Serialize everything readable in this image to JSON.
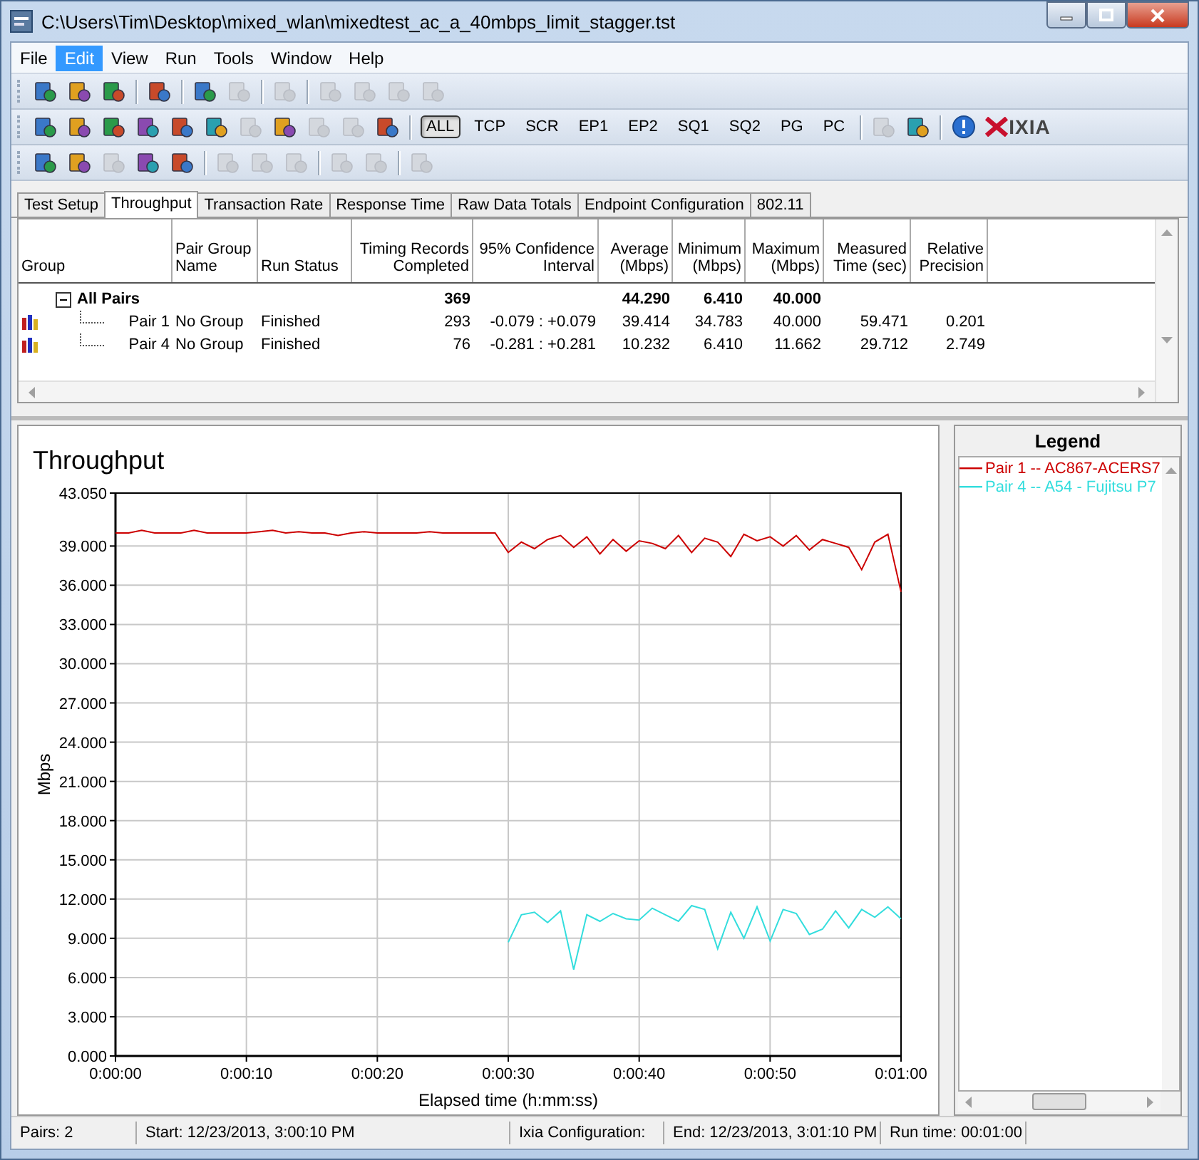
{
  "window": {
    "title": "C:\\Users\\Tim\\Desktop\\mixed_wlan\\mixedtest_ac_a_40mbps_limit_stagger.tst"
  },
  "menu": [
    {
      "label": "File",
      "selected": false
    },
    {
      "label": "Edit",
      "selected": true
    },
    {
      "label": "View",
      "selected": false
    },
    {
      "label": "Run",
      "selected": false
    },
    {
      "label": "Tools",
      "selected": false
    },
    {
      "label": "Window",
      "selected": false
    },
    {
      "label": "Help",
      "selected": false
    }
  ],
  "toolbars": [
    [
      {
        "kind": "icon",
        "disabled": false
      },
      {
        "kind": "icon",
        "disabled": false
      },
      {
        "kind": "icon",
        "disabled": false
      },
      {
        "kind": "separator"
      },
      {
        "kind": "icon",
        "disabled": false
      },
      {
        "kind": "separator"
      },
      {
        "kind": "icon",
        "disabled": false
      },
      {
        "kind": "icon",
        "disabled": true
      },
      {
        "kind": "separator"
      },
      {
        "kind": "icon",
        "disabled": true
      },
      {
        "kind": "separator"
      },
      {
        "kind": "icon",
        "disabled": true
      },
      {
        "kind": "icon",
        "disabled": true
      },
      {
        "kind": "icon",
        "disabled": true
      },
      {
        "kind": "icon",
        "disabled": true
      }
    ],
    [
      {
        "kind": "icon",
        "disabled": false
      },
      {
        "kind": "icon",
        "disabled": false
      },
      {
        "kind": "icon",
        "disabled": false
      },
      {
        "kind": "icon",
        "disabled": false
      },
      {
        "kind": "icon",
        "disabled": false
      },
      {
        "kind": "icon",
        "disabled": false
      },
      {
        "kind": "icon",
        "disabled": true
      },
      {
        "kind": "icon",
        "disabled": false
      },
      {
        "kind": "icon",
        "disabled": true
      },
      {
        "kind": "icon",
        "disabled": true
      },
      {
        "kind": "icon",
        "disabled": false
      },
      {
        "kind": "separator"
      },
      {
        "kind": "toggle",
        "label": "ALL",
        "selected": true
      },
      {
        "kind": "toggle",
        "label": "TCP",
        "selected": false
      },
      {
        "kind": "toggle",
        "label": "SCR",
        "selected": false
      },
      {
        "kind": "toggle",
        "label": "EP1",
        "selected": false
      },
      {
        "kind": "toggle",
        "label": "EP2",
        "selected": false
      },
      {
        "kind": "toggle",
        "label": "SQ1",
        "selected": false
      },
      {
        "kind": "toggle",
        "label": "SQ2",
        "selected": false
      },
      {
        "kind": "toggle",
        "label": "PG",
        "selected": false
      },
      {
        "kind": "toggle",
        "label": "PC",
        "selected": false
      },
      {
        "kind": "separator"
      },
      {
        "kind": "icon",
        "disabled": true
      },
      {
        "kind": "icon",
        "disabled": false
      },
      {
        "kind": "separator"
      },
      {
        "kind": "info"
      },
      {
        "kind": "logo",
        "label": "IXIA"
      }
    ],
    [
      {
        "kind": "icon",
        "disabled": false
      },
      {
        "kind": "icon",
        "disabled": false
      },
      {
        "kind": "icon",
        "disabled": true
      },
      {
        "kind": "icon",
        "disabled": false
      },
      {
        "kind": "icon",
        "disabled": false
      },
      {
        "kind": "separator"
      },
      {
        "kind": "icon",
        "disabled": true
      },
      {
        "kind": "icon",
        "disabled": true
      },
      {
        "kind": "icon",
        "disabled": true
      },
      {
        "kind": "separator"
      },
      {
        "kind": "icon",
        "disabled": true
      },
      {
        "kind": "icon",
        "disabled": true
      },
      {
        "kind": "separator"
      },
      {
        "kind": "icon",
        "disabled": true
      }
    ]
  ],
  "tabs": [
    {
      "label": "Test Setup",
      "selected": false
    },
    {
      "label": "Throughput",
      "selected": true
    },
    {
      "label": "Transaction Rate",
      "selected": false
    },
    {
      "label": "Response Time",
      "selected": false
    },
    {
      "label": "Raw Data Totals",
      "selected": false
    },
    {
      "label": "Endpoint Configuration",
      "selected": false
    },
    {
      "label": "802.11",
      "selected": false
    }
  ],
  "table": {
    "columns": [
      "Group",
      "Pair Group\nName",
      "Run Status",
      "Timing Records\nCompleted",
      "95% Confidence\nInterval",
      "Average\n(Mbps)",
      "Minimum\n(Mbps)",
      "Maximum\n(Mbps)",
      "Measured\nTime (sec)",
      "Relative\nPrecision"
    ],
    "rows": [
      {
        "expanded": true,
        "cells": [
          "All Pairs",
          "",
          "",
          "369",
          "",
          "44.290",
          "6.410",
          "40.000",
          "",
          ""
        ],
        "children": [
          {
            "cells": [
              "Pair 1",
              "No Group",
              "Finished",
              "293",
              "-0.079 : +0.079",
              "39.414",
              "34.783",
              "40.000",
              "59.471",
              "0.201"
            ]
          },
          {
            "cells": [
              "Pair 4",
              "No Group",
              "Finished",
              "76",
              "-0.281 : +0.281",
              "10.232",
              "6.410",
              "11.662",
              "29.712",
              "2.749"
            ]
          }
        ]
      }
    ]
  },
  "chart_panel": {
    "chart_data": {
      "type": "line",
      "title": "Throughput",
      "xlabel": "Elapsed time (h:mm:ss)",
      "ylabel": "Mbps",
      "x": [
        0,
        1,
        2,
        3,
        4,
        5,
        6,
        7,
        8,
        9,
        10,
        11,
        12,
        13,
        14,
        15,
        16,
        17,
        18,
        19,
        20,
        21,
        22,
        23,
        24,
        25,
        26,
        27,
        28,
        29,
        30,
        31,
        32,
        33,
        34,
        35,
        36,
        37,
        38,
        39,
        40,
        41,
        42,
        43,
        44,
        45,
        46,
        47,
        48,
        49,
        50,
        51,
        52,
        53,
        54,
        55,
        56,
        57,
        58,
        59,
        60
      ],
      "xlim": [
        0,
        60
      ],
      "ylim": [
        0,
        43.05
      ],
      "grid": true,
      "xticks": [
        {
          "value": 0,
          "label": "0:00:00"
        },
        {
          "value": 10,
          "label": "0:00:10"
        },
        {
          "value": 20,
          "label": "0:00:20"
        },
        {
          "value": 30,
          "label": "0:00:30"
        },
        {
          "value": 40,
          "label": "0:00:40"
        },
        {
          "value": 50,
          "label": "0:00:50"
        },
        {
          "value": 60,
          "label": "0:01:00"
        }
      ],
      "yticks": [
        {
          "value": 0,
          "label": "0.000"
        },
        {
          "value": 3,
          "label": "3.000"
        },
        {
          "value": 6,
          "label": "6.000"
        },
        {
          "value": 9,
          "label": "9.000"
        },
        {
          "value": 12,
          "label": "12.000"
        },
        {
          "value": 15,
          "label": "15.000"
        },
        {
          "value": 18,
          "label": "18.000"
        },
        {
          "value": 21,
          "label": "21.000"
        },
        {
          "value": 24,
          "label": "24.000"
        },
        {
          "value": 27,
          "label": "27.000"
        },
        {
          "value": 30,
          "label": "30.000"
        },
        {
          "value": 33,
          "label": "33.000"
        },
        {
          "value": 36,
          "label": "36.000"
        },
        {
          "value": 39,
          "label": "39.000"
        },
        {
          "value": 43.05,
          "label": "43.050"
        }
      ],
      "series": [
        {
          "name": "Pair 1 -- AC867-ACERS7",
          "color": "#cc0000",
          "values": [
            40.0,
            40.0,
            40.2,
            40.0,
            40.0,
            40.0,
            40.2,
            40.0,
            40.0,
            40.0,
            40.0,
            40.1,
            40.2,
            40.0,
            40.1,
            40.0,
            40.0,
            39.8,
            40.0,
            40.1,
            40.0,
            40.0,
            40.0,
            40.0,
            40.1,
            40.0,
            40.0,
            40.0,
            40.0,
            40.0,
            38.5,
            39.3,
            38.8,
            39.5,
            39.8,
            38.9,
            39.7,
            38.4,
            39.5,
            38.6,
            39.4,
            39.2,
            38.8,
            39.8,
            38.5,
            39.6,
            39.3,
            38.2,
            39.9,
            39.4,
            39.7,
            39.0,
            39.8,
            38.7,
            39.5,
            39.2,
            38.9,
            37.2,
            39.3,
            39.9,
            35.5
          ]
        },
        {
          "name": "Pair 4 -- A54 - Fujitsu P7",
          "color": "#33dddd",
          "values": [
            null,
            null,
            null,
            null,
            null,
            null,
            null,
            null,
            null,
            null,
            null,
            null,
            null,
            null,
            null,
            null,
            null,
            null,
            null,
            null,
            null,
            null,
            null,
            null,
            null,
            null,
            null,
            null,
            null,
            null,
            8.7,
            10.8,
            11.0,
            10.2,
            11.1,
            6.6,
            10.8,
            10.3,
            10.9,
            10.5,
            10.4,
            11.3,
            10.8,
            10.3,
            11.5,
            11.2,
            8.2,
            11.0,
            9.0,
            11.4,
            8.8,
            11.2,
            10.9,
            9.3,
            9.7,
            11.1,
            9.8,
            11.2,
            10.6,
            11.4,
            10.5
          ]
        }
      ]
    }
  },
  "legend": {
    "title": "Legend"
  },
  "status_bar": [
    "Pairs: 2",
    "Start: 12/23/2013, 3:00:10 PM",
    "Ixia Configuration:",
    "End: 12/23/2013, 3:01:10 PM",
    "Run time: 00:01:00"
  ]
}
